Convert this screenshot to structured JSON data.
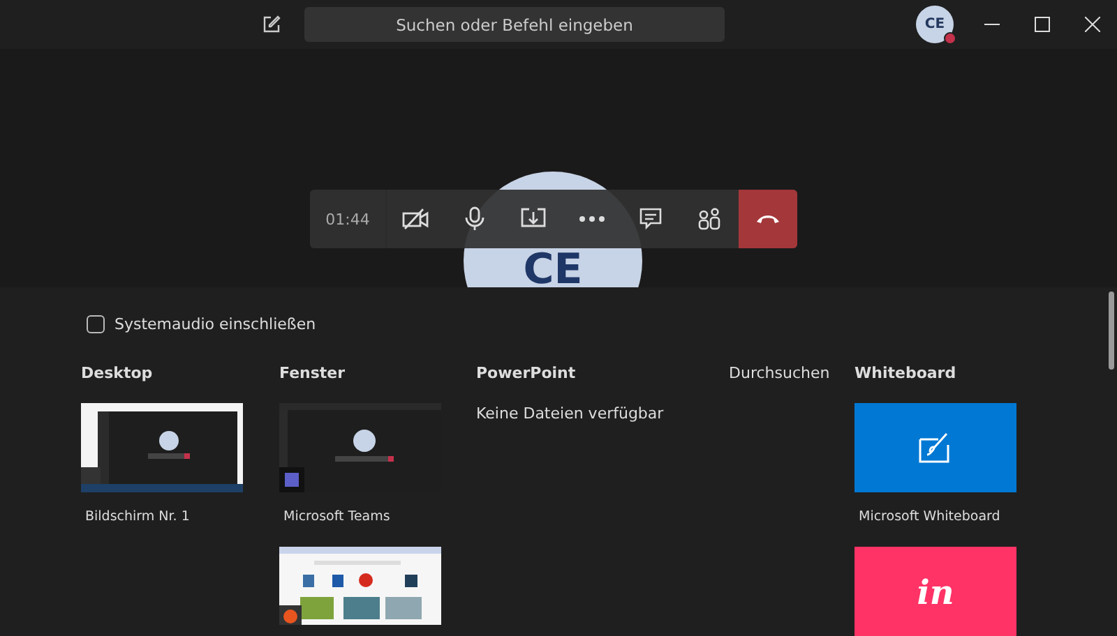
{
  "title_bar": {
    "search": {
      "placeholder": "Suchen oder Befehl eingeben"
    },
    "avatar": {
      "initials": "CE"
    }
  },
  "call": {
    "avatar": "CE",
    "timer": "01:44"
  },
  "share_tray": {
    "system_audio": {
      "label": "Systemaudio einschließen",
      "checked": false
    },
    "sections": [
      {
        "heading": "Desktop",
        "kind": "category",
        "items": [
          {
            "kind": "desktop",
            "caption": "Bildschirm Nr. 1"
          }
        ]
      },
      {
        "heading": "Fenster",
        "kind": "category",
        "items": [
          {
            "kind": "window",
            "caption": "Microsoft Teams"
          },
          {
            "kind": "browser"
          }
        ]
      },
      {
        "heading": "PowerPoint",
        "kind": "category",
        "message": "Keine Dateien verfügbar"
      },
      {
        "heading": "Durchsuchen",
        "kind": "link"
      },
      {
        "heading": "Whiteboard",
        "kind": "category",
        "items": [
          {
            "kind": "whiteboard",
            "caption": "Microsoft Whiteboard"
          },
          {
            "kind": "invision",
            "logo": "in"
          }
        ]
      }
    ]
  }
}
